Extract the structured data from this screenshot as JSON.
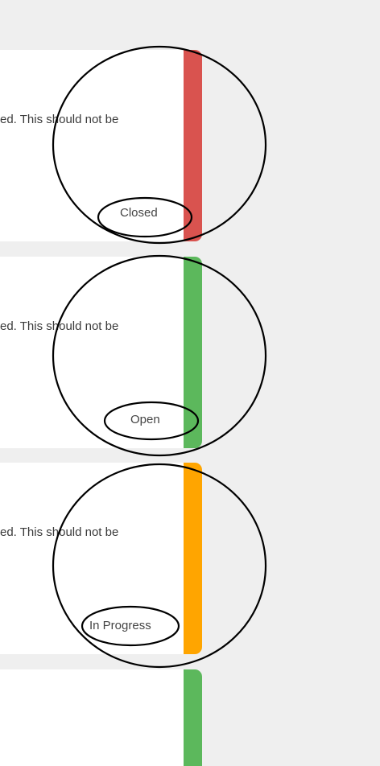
{
  "cards": [
    {
      "text": "ed. This should not be",
      "status": "Closed",
      "status_color": "#d9534f"
    },
    {
      "text": "ed. This should not be",
      "status": "Open",
      "status_color": "#5cb85c"
    },
    {
      "text": "ed. This should not be",
      "status": "In Progress",
      "status_color": "#ffa500"
    },
    {
      "text": "",
      "status": "",
      "status_color": "#5cb85c"
    }
  ],
  "annotation": {
    "stroke_color": "#000000"
  }
}
